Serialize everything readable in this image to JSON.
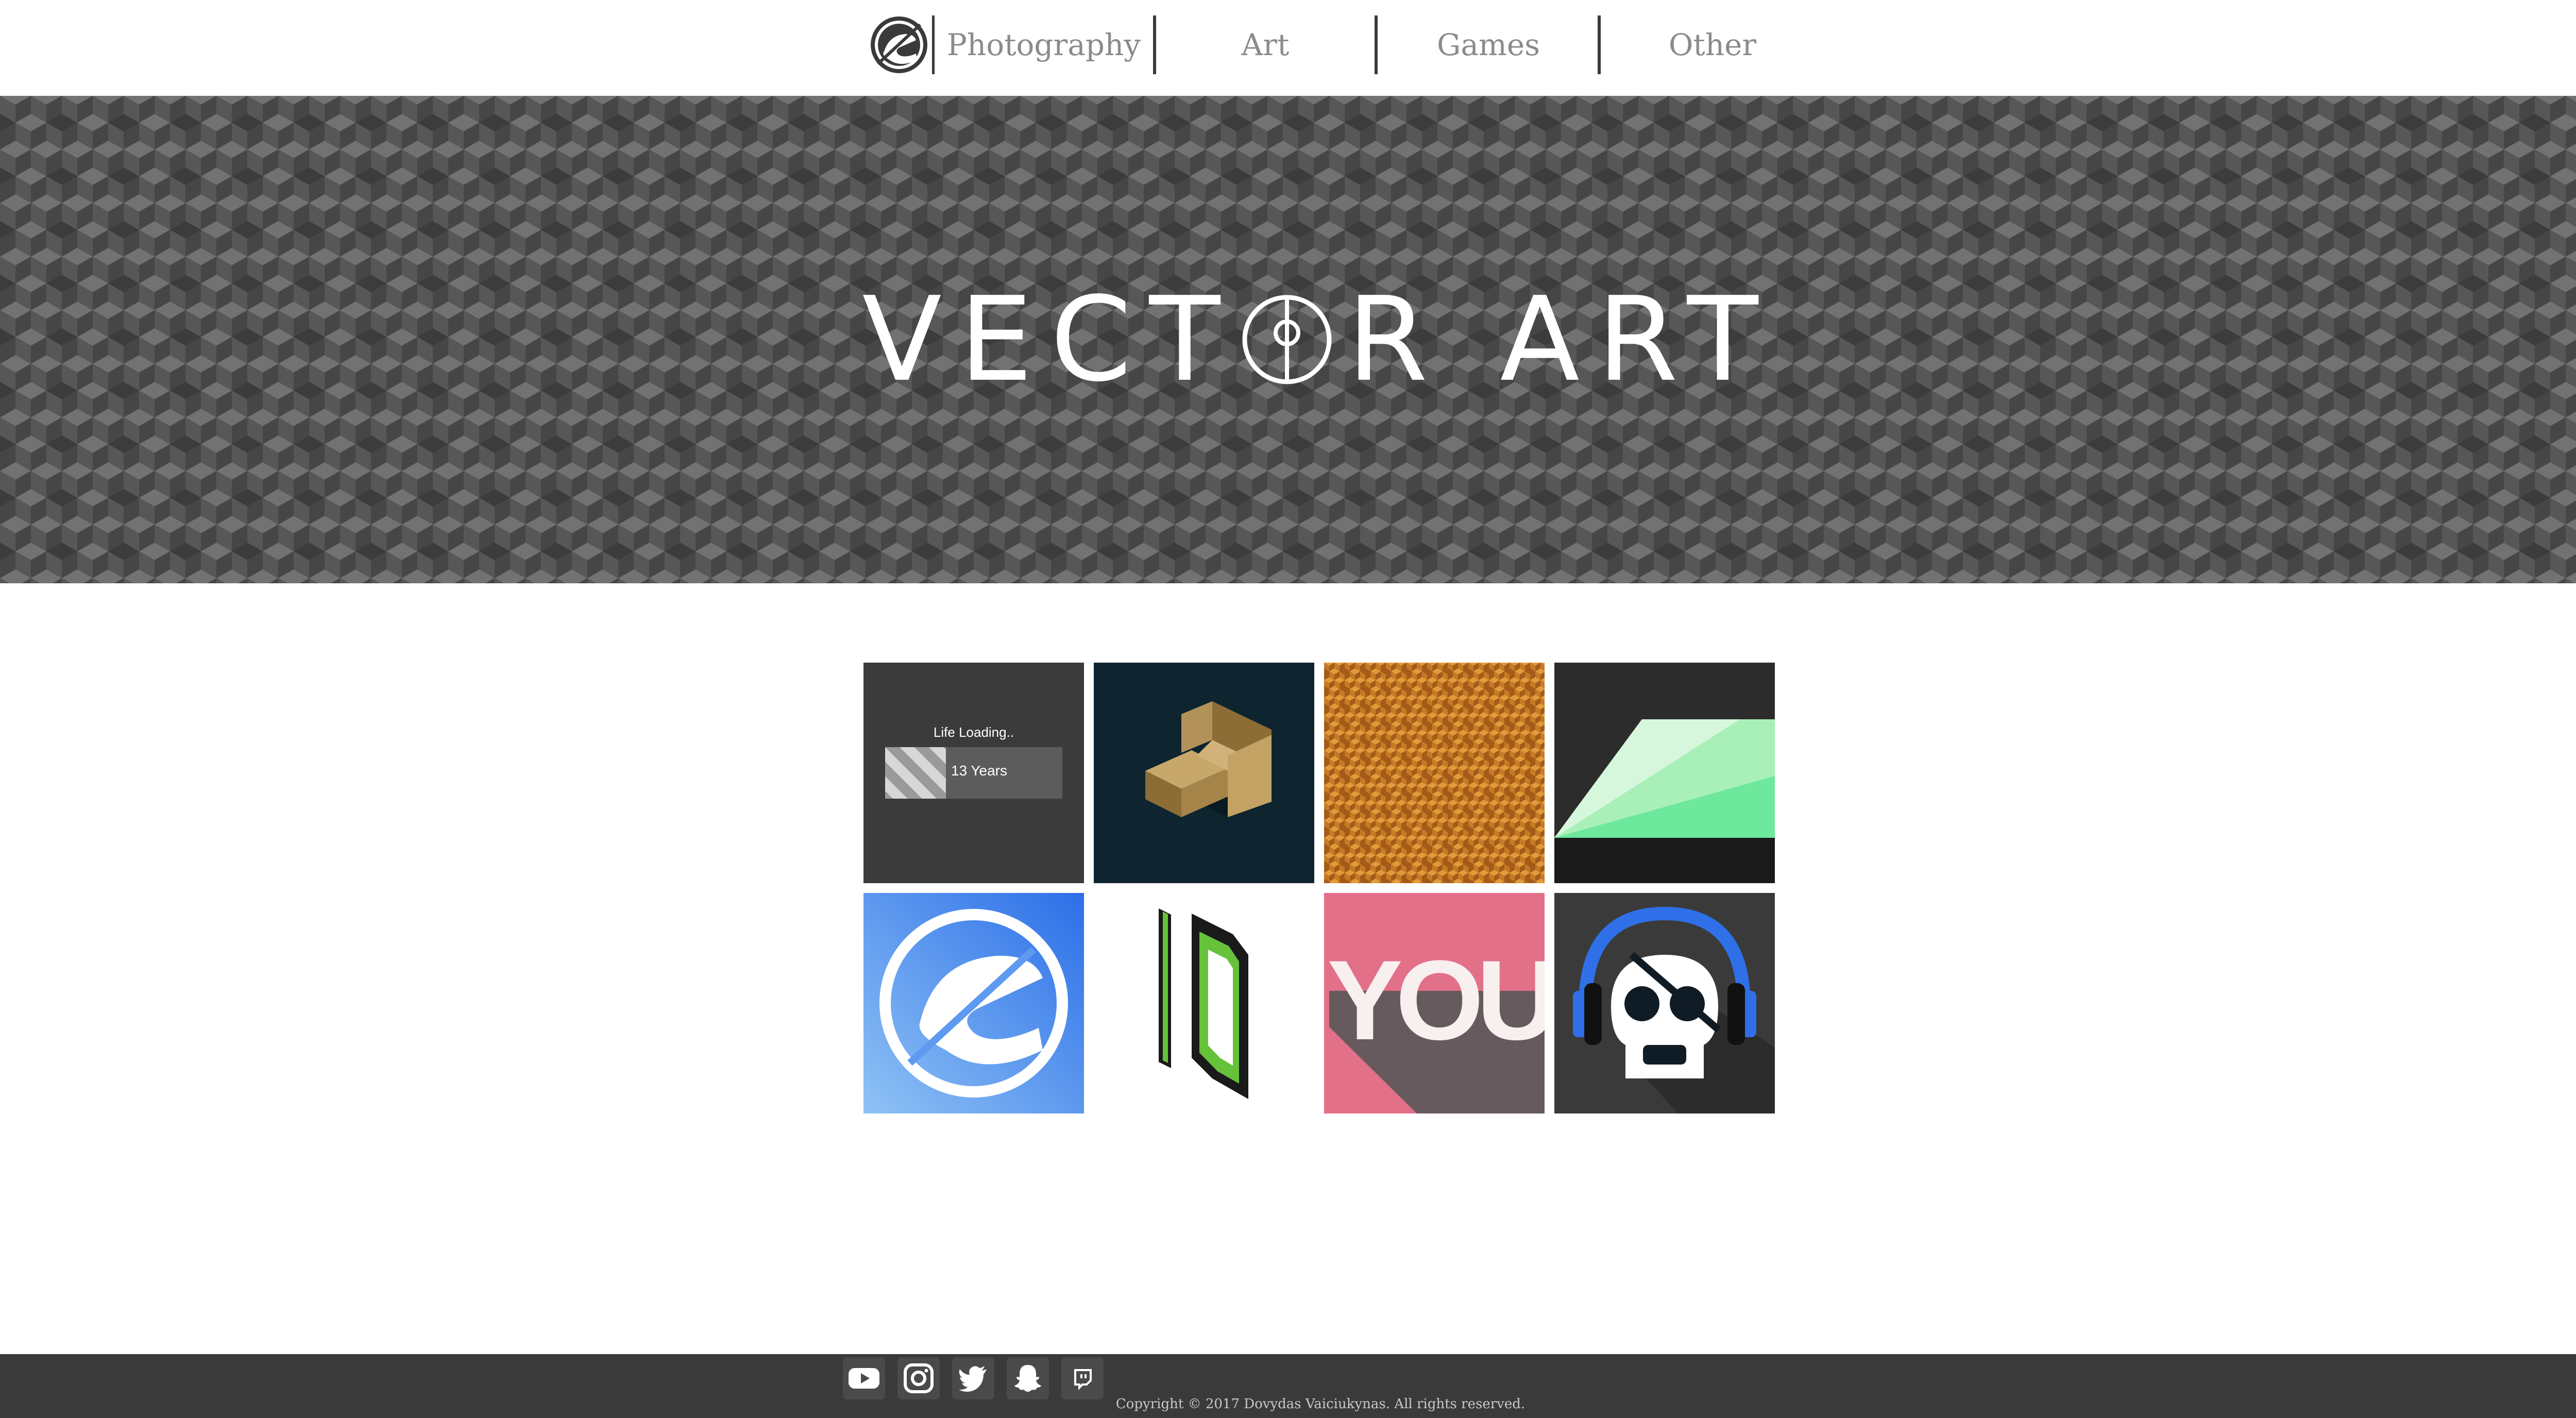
{
  "nav": {
    "logo_icon": "dv-logo-icon",
    "items": [
      {
        "label": "Photography"
      },
      {
        "label": "Art"
      },
      {
        "label": "Games"
      },
      {
        "label": "Other"
      }
    ]
  },
  "hero": {
    "title_part1": "VECT",
    "title_part2": "R ART",
    "background": "isometric-cube-pattern"
  },
  "gallery": {
    "tiles": [
      {
        "name": "life-loading-art",
        "heading": "Life Loading..",
        "bar_label": "13 Years"
      },
      {
        "name": "isometric-box-art"
      },
      {
        "name": "orange-cube-pattern-art"
      },
      {
        "name": "green-trapezoid-art"
      },
      {
        "name": "blue-logo-art"
      },
      {
        "name": "id-letters-art"
      },
      {
        "name": "you-text-art",
        "text": "YOU"
      },
      {
        "name": "skull-headphones-art"
      }
    ]
  },
  "footer": {
    "social": [
      "youtube-icon",
      "instagram-icon",
      "twitter-icon",
      "snapchat-icon",
      "twitch-icon"
    ],
    "copyright": "Copyright © 2017 Dovydas Vaiciukynas. All rights reserved."
  },
  "colors": {
    "nav_text": "#8b8b8b",
    "footer_bg": "#3a3a3a",
    "hero_cube_dark": "#3c3c3c",
    "hero_cube_mid": "#575757",
    "hero_cube_light": "#727272"
  }
}
